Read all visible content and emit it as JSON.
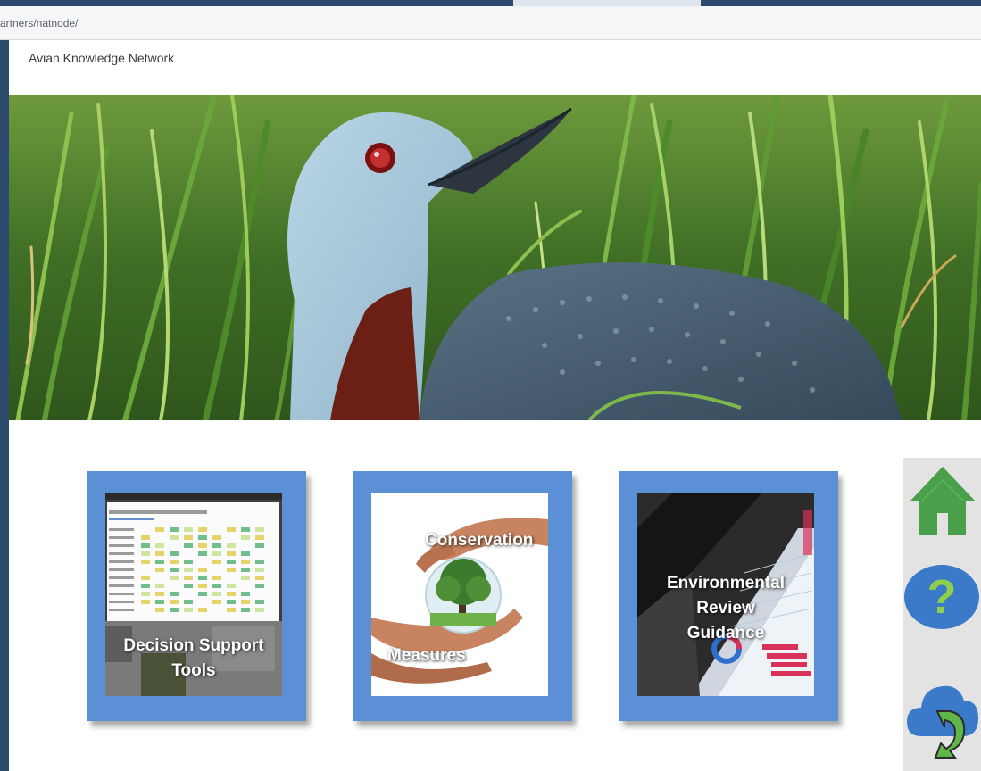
{
  "browser": {
    "url_partial": "artners/natnode/"
  },
  "site": {
    "title": "Avian Knowledge Network"
  },
  "hero": {
    "subject": "red-throated loon in grass"
  },
  "tiles": [
    {
      "label_lines": [
        "Decision Support",
        "Tools"
      ]
    },
    {
      "label_top": "Conservation",
      "label_bottom": "Measures"
    },
    {
      "label_lines": [
        "Environmental",
        "Review",
        "Guidance"
      ]
    }
  ],
  "side_nav": [
    {
      "icon": "home-icon",
      "color": "#4aa04a"
    },
    {
      "icon": "help-icon",
      "color": "#3b79c9",
      "glyph": "?"
    },
    {
      "icon": "cloud-sync-icon",
      "color": "#3b79c9"
    }
  ],
  "colors": {
    "tile_frame": "#5b8fd6",
    "frame": "#2b4a6e"
  }
}
